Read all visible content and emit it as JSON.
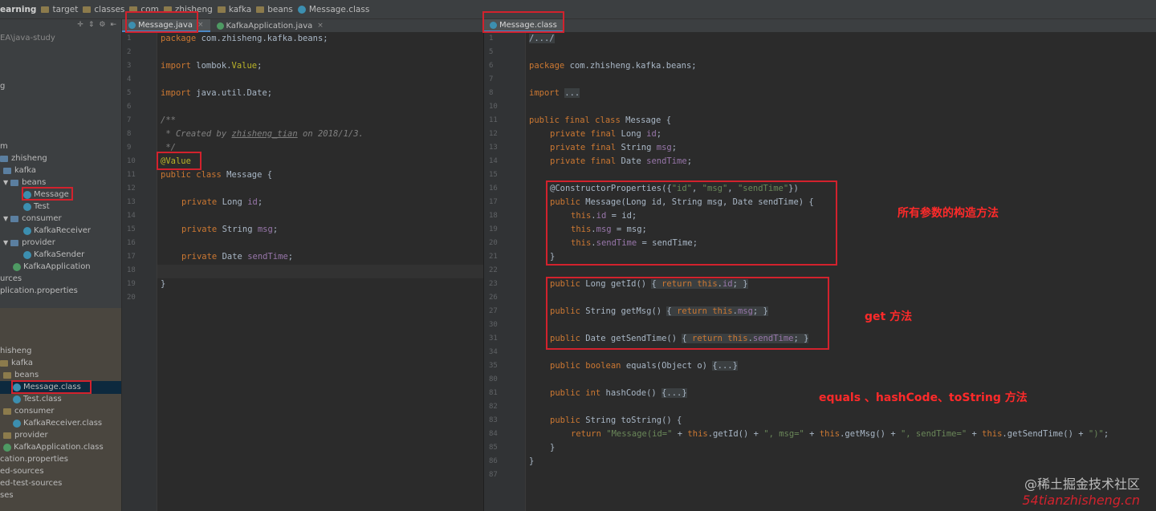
{
  "breadcrumb": {
    "items": [
      "earning",
      "target",
      "classes",
      "com",
      "zhisheng",
      "kafka",
      "beans",
      "Message.class"
    ]
  },
  "project": {
    "toolbar_icons": [
      "sync-icon",
      "collapse-icon",
      "gear-icon",
      "hide-icon"
    ],
    "path": "EA\\java-study",
    "rows": [
      {
        "label": "g"
      },
      {
        "label": "m"
      },
      {
        "label": "zhisheng"
      },
      {
        "label": "kafka"
      },
      {
        "label": "beans"
      },
      {
        "label": "Message"
      },
      {
        "label": "Test"
      },
      {
        "label": "consumer"
      },
      {
        "label": "KafkaReceiver"
      },
      {
        "label": "provider"
      },
      {
        "label": "KafkaSender"
      },
      {
        "label": "KafkaApplication"
      },
      {
        "label": "urces"
      },
      {
        "label": "plication.properties"
      },
      {
        "label": "hisheng"
      },
      {
        "label": "kafka"
      },
      {
        "label": "beans"
      },
      {
        "label": "Message.class"
      },
      {
        "label": "Test.class"
      },
      {
        "label": "consumer"
      },
      {
        "label": "KafkaReceiver.class"
      },
      {
        "label": "provider"
      },
      {
        "label": "KafkaApplication.class"
      },
      {
        "label": "cation.properties"
      },
      {
        "label": "ed-sources"
      },
      {
        "label": "ed-test-sources"
      },
      {
        "label": "ses"
      }
    ]
  },
  "left_editor": {
    "tabs": [
      {
        "label": "Message.java",
        "active": true
      },
      {
        "label": "KafkaApplication.java",
        "active": false
      }
    ],
    "line_numbers": [
      "1",
      "2",
      "3",
      "4",
      "5",
      "6",
      "7",
      "8",
      "9",
      "10",
      "11",
      "12",
      "13",
      "14",
      "15",
      "16",
      "17",
      "18",
      "19",
      "20"
    ]
  },
  "right_editor": {
    "tabs": [
      {
        "label": "Message.class",
        "active": true
      }
    ],
    "line_numbers": [
      "1",
      "5",
      "6",
      "7",
      "8",
      "10",
      "11",
      "12",
      "13",
      "14",
      "15",
      "16",
      "17",
      "18",
      "19",
      "20",
      "21",
      "22",
      "23",
      "26",
      "27",
      "30",
      "31",
      "34",
      "35",
      "80",
      "81",
      "82",
      "83",
      "84",
      "85",
      "86",
      "87"
    ]
  },
  "annotations": {
    "constructor": "所有参数的构造方法",
    "getters": "get 方法",
    "others": "equals 、hashCode、toString 方法"
  },
  "watermark": {
    "line1": "@稀土掘金技术社区",
    "line2": "54tianzhisheng.cn"
  },
  "colors": {
    "keyword": "#cc7832",
    "field": "#9876aa",
    "string": "#6a8759",
    "annotation": "#bbb529",
    "comment": "#808080",
    "highlight_box": "#d2222d"
  }
}
